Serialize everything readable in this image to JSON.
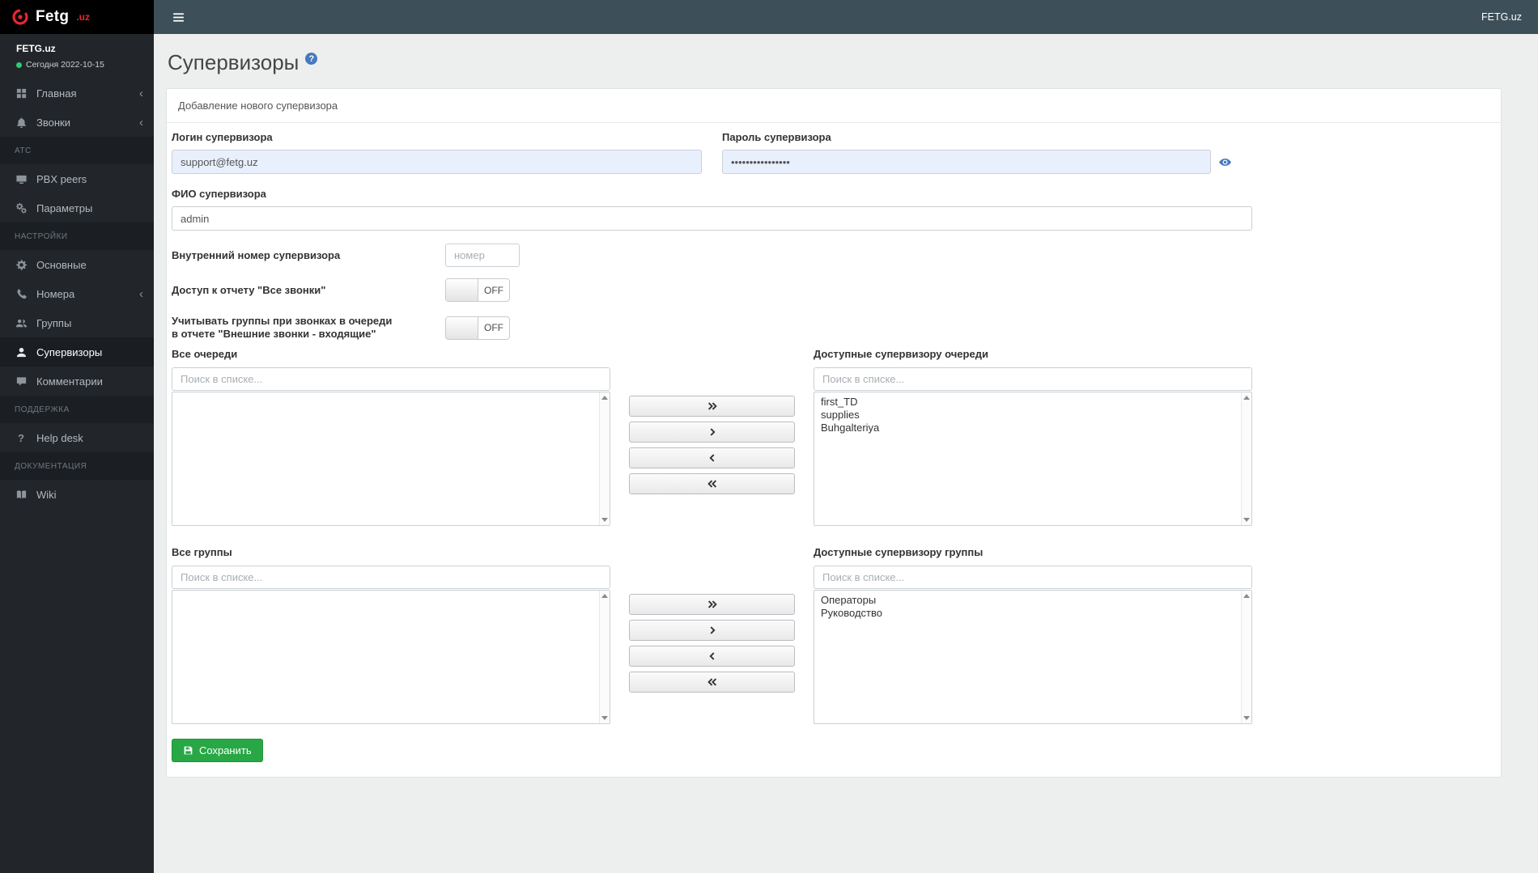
{
  "topbar": {
    "brand": "FETG.uz"
  },
  "icons": {
    "help": "?",
    "chevron_left": "‹"
  },
  "sidebar": {
    "org": "FETG.uz",
    "date": "Сегодня 2022-10-15",
    "logo_main": "Fetg",
    "logo_suffix": ".uz",
    "items": [
      {
        "label": "Главная"
      },
      {
        "label": "Звонки"
      },
      {
        "label": "АТС"
      },
      {
        "label": "PBX peers"
      },
      {
        "label": "Параметры"
      },
      {
        "label": "НАСТРОЙКИ"
      },
      {
        "label": "Основные"
      },
      {
        "label": "Номера"
      },
      {
        "label": "Группы"
      },
      {
        "label": "Супервизоры"
      },
      {
        "label": "Комментарии"
      },
      {
        "label": "ПОДДЕРЖКА"
      },
      {
        "label": "Help desk"
      },
      {
        "label": "ДОКУМЕНТАЦИЯ"
      },
      {
        "label": "Wiki"
      }
    ]
  },
  "page": {
    "title": "Супервизоры"
  },
  "card": {
    "title": "Добавление нового супервизора"
  },
  "form": {
    "login_label": "Логин супервизора",
    "login_value": "support@fetg.uz",
    "password_label": "Пароль супервизора",
    "password_value": "••••••••••••••••",
    "fio_label": "ФИО супервизора",
    "fio_value": "admin",
    "number_label": "Внутренний номер супервизора",
    "number_placeholder": "номер",
    "all_calls_label": "Доступ к отчету \"Все звонки\"",
    "queue_groups_label_line1": "Учитывать группы при звонках в очереди",
    "queue_groups_label_line2": "в отчете \"Внешние звонки - входящие\"",
    "toggle_off": "OFF",
    "search_placeholder": "Поиск в списке...",
    "queues": {
      "all_title": "Все очереди",
      "available_title": "Доступные супервизору очереди",
      "all_items": [],
      "available_items": [
        "first_TD",
        "supplies",
        "Buhgalteriya"
      ]
    },
    "groups": {
      "all_title": "Все группы",
      "available_title": "Доступные супервизору группы",
      "all_items": [],
      "available_items": [
        "Операторы",
        "Руководство"
      ]
    },
    "save_label": "Сохранить"
  }
}
